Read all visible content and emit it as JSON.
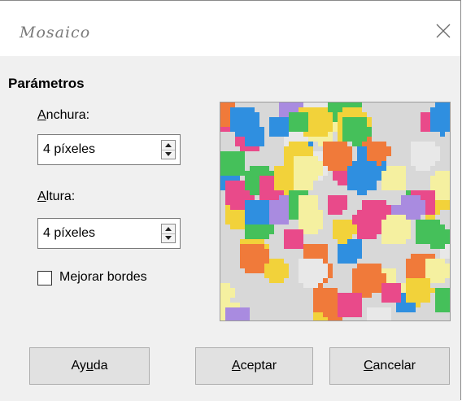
{
  "dialog": {
    "title": "Mosaico",
    "close_symbol": "×"
  },
  "parameters": {
    "section_title": "Parámetros",
    "width": {
      "label_accel": "A",
      "label_rest": "nchura:",
      "value": "4 píxeles"
    },
    "height": {
      "label_accel": "A",
      "label_rest": "ltura:",
      "value": "4 píxeles"
    },
    "enhance_edges": {
      "label_pre": "Me",
      "label_accel": "j",
      "label_post": "orar bordes",
      "checked": false
    }
  },
  "preview": {
    "icon": "mosaic-preview-image"
  },
  "buttons": {
    "help": {
      "pre": "Ay",
      "accel": "u",
      "post": "da"
    },
    "ok": {
      "pre": "",
      "accel": "A",
      "post": "ceptar"
    },
    "cancel": {
      "pre": "",
      "accel": "C",
      "post": "ancelar"
    }
  },
  "colors": {
    "dialog_bg": "#f0f0f0",
    "title_bg": "#ffffff",
    "button_bg": "#e1e1e1"
  }
}
